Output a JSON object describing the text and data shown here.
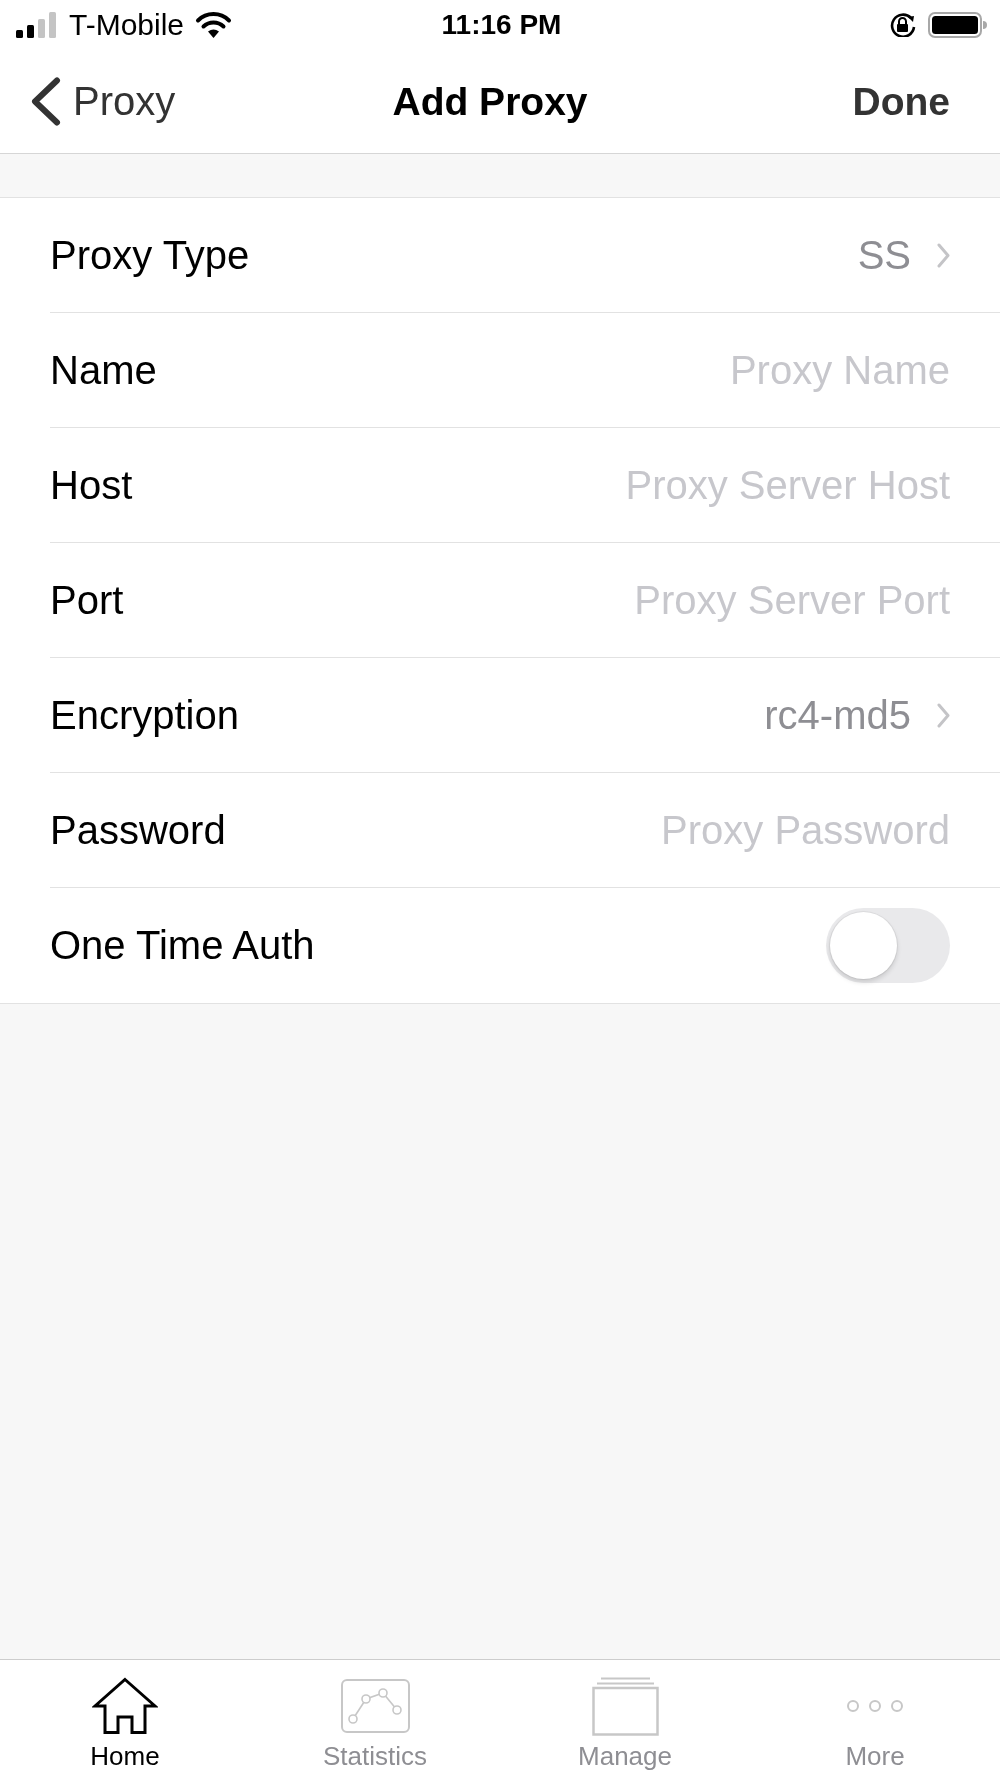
{
  "status_bar": {
    "carrier": "T-Mobile",
    "time": "11:16 PM"
  },
  "nav_bar": {
    "back_label": "Proxy",
    "title": "Add Proxy",
    "action": "Done"
  },
  "form": {
    "rows": [
      {
        "kind": "select",
        "label": "Proxy Type",
        "value": "SS"
      },
      {
        "kind": "input",
        "label": "Name",
        "placeholder": "Proxy Name"
      },
      {
        "kind": "input",
        "label": "Host",
        "placeholder": "Proxy Server Host"
      },
      {
        "kind": "input",
        "label": "Port",
        "placeholder": "Proxy Server Port"
      },
      {
        "kind": "select",
        "label": "Encryption",
        "value": "rc4-md5"
      },
      {
        "kind": "input",
        "label": "Password",
        "placeholder": "Proxy Password"
      },
      {
        "kind": "toggle",
        "label": "One Time Auth",
        "on": false
      }
    ]
  },
  "tab_bar": {
    "tabs": [
      {
        "label": "Home",
        "selected": true
      },
      {
        "label": "Statistics",
        "selected": false
      },
      {
        "label": "Manage",
        "selected": false
      },
      {
        "label": "More",
        "selected": false
      }
    ]
  }
}
